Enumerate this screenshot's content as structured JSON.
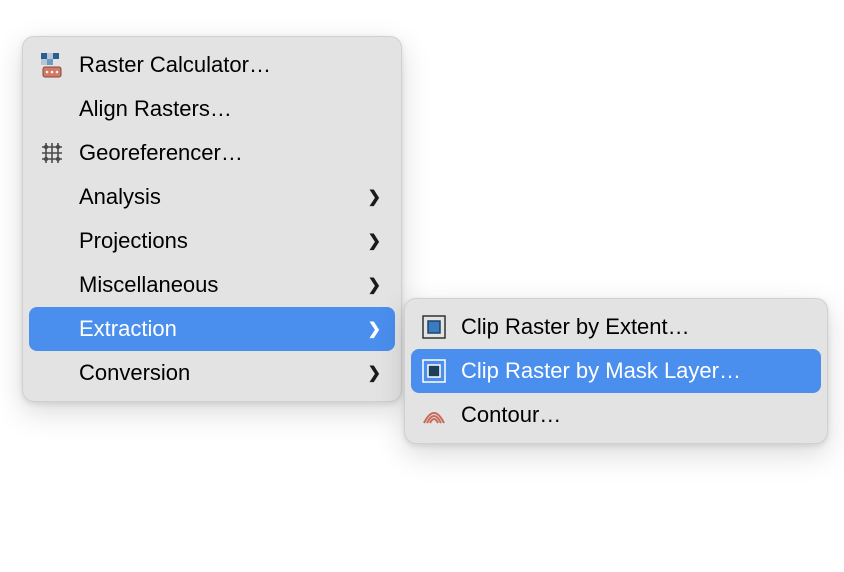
{
  "main_menu": {
    "items": [
      {
        "label": "Raster Calculator…",
        "icon": "raster-calc-icon",
        "submenu": false
      },
      {
        "label": "Align Rasters…",
        "icon": null,
        "submenu": false
      },
      {
        "label": "Georeferencer…",
        "icon": "georef-icon",
        "submenu": false
      },
      {
        "label": "Analysis",
        "icon": null,
        "submenu": true
      },
      {
        "label": "Projections",
        "icon": null,
        "submenu": true
      },
      {
        "label": "Miscellaneous",
        "icon": null,
        "submenu": true
      },
      {
        "label": "Extraction",
        "icon": null,
        "submenu": true,
        "highlighted": true
      },
      {
        "label": "Conversion",
        "icon": null,
        "submenu": true
      }
    ]
  },
  "sub_menu": {
    "parent": "Extraction",
    "items": [
      {
        "label": "Clip Raster by Extent…",
        "icon": "clip-extent-icon"
      },
      {
        "label": "Clip Raster by Mask Layer…",
        "icon": "clip-mask-icon",
        "highlighted": true
      },
      {
        "label": "Contour…",
        "icon": "contour-icon"
      }
    ]
  },
  "colors": {
    "menu_bg": "#e3e3e3",
    "highlight": "#4a8eee",
    "highlight_text": "#ffffff"
  }
}
